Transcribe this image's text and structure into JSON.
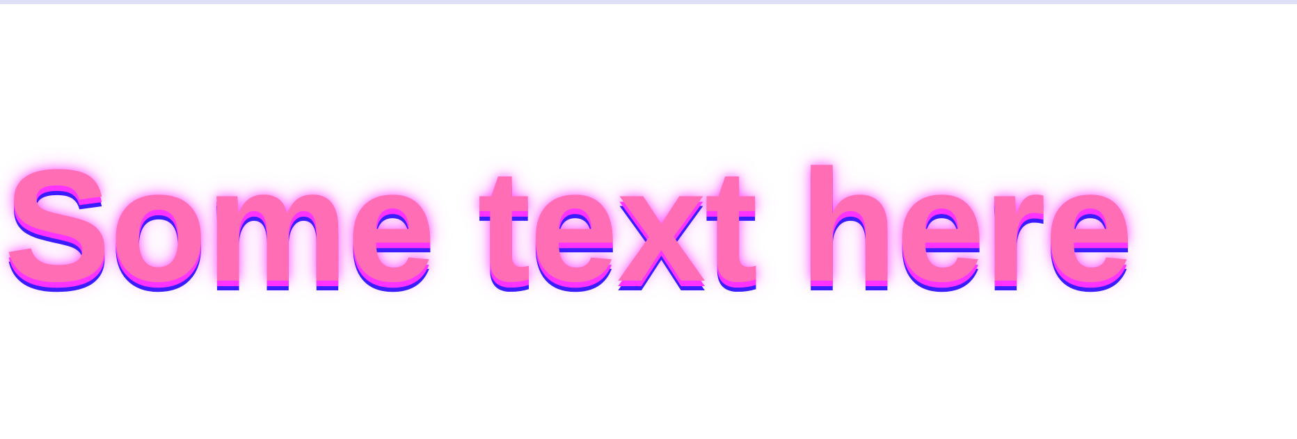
{
  "page": {
    "top_bar_color": "#dfe0f8",
    "background_color": "#ffffff"
  },
  "headline": {
    "text": "Some text here",
    "fill_color": "#ff6eb4",
    "shadow_colors": [
      "#ff33ff",
      "#3b1cff"
    ],
    "glow_color": "#ff00ff"
  }
}
